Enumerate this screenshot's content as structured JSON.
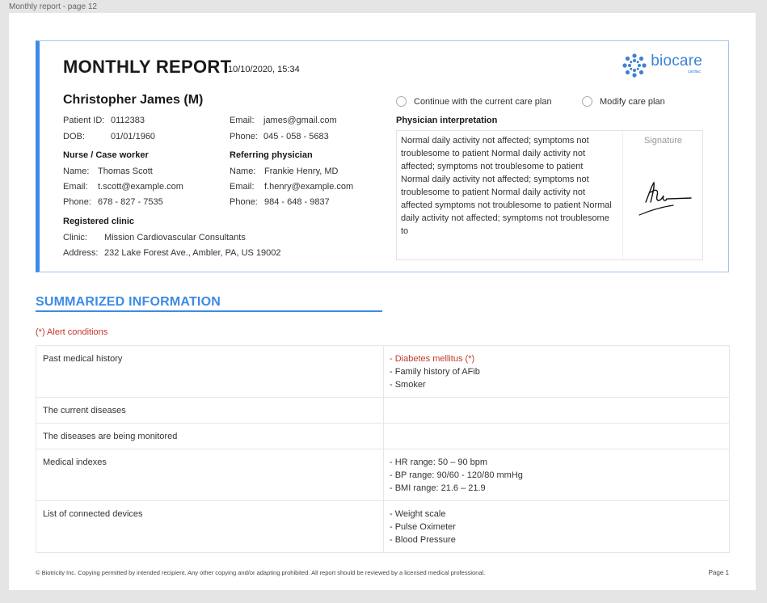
{
  "frame_label": "Monthly report - page 12",
  "report": {
    "title": "MONTHLY REPORT",
    "datetime": "10/10/2020, 15:34"
  },
  "logo": {
    "name": "biocare",
    "sub": "cardiac"
  },
  "patient": {
    "name": "Christopher James (M)",
    "id_label": "Patient ID:",
    "id": "0112383",
    "dob_label": "DOB:",
    "dob": "01/01/1960",
    "email_label": "Email:",
    "email": "james@gmail.com",
    "phone_label": "Phone:",
    "phone": "045 - 058 - 5683"
  },
  "nurse": {
    "heading": "Nurse / Case worker",
    "name_label": "Name:",
    "name": "Thomas Scott",
    "email_label": "Email:",
    "email": "t.scott@example.com",
    "phone_label": "Phone:",
    "phone": "678 - 827 - 7535"
  },
  "physician": {
    "heading": "Referring physician",
    "name_label": "Name:",
    "name": "Frankie Henry, MD",
    "email_label": "Email:",
    "email": "f.henry@example.com",
    "phone_label": "Phone:",
    "phone": "984 - 648 - 9837"
  },
  "clinic": {
    "heading": "Registered clinic",
    "clinic_label": "Clinic:",
    "clinic": "Mission Cardiovascular Consultants",
    "address_label": "Address:",
    "address": "232 Lake Forest Ave., Ambler, PA, US 19002"
  },
  "care_plan": {
    "option_continue": "Continue with the current care plan",
    "option_modify": "Modify care plan"
  },
  "interpretation": {
    "heading": "Physician interpretation",
    "text": "Normal daily activity not affected; symptoms not troublesome to patient Normal daily activity not affected; symptoms not troublesome to patient Normal daily activity not affected; symptoms not troublesome to patient Normal daily activity not affected symptoms not troublesome to patient Normal daily activity not affected; symptoms not troublesome to",
    "signature_label": "Signature"
  },
  "summary": {
    "title": "SUMMARIZED INFORMATION",
    "alert_note": "(*) Alert conditions",
    "rows": [
      {
        "label": "Past medical history",
        "items": [
          {
            "text": "- Diabetes mellitus (*)",
            "alert": true
          },
          {
            "text": "- Family history of AFib",
            "alert": false
          },
          {
            "text": "- Smoker",
            "alert": false
          }
        ]
      },
      {
        "label": "The current diseases",
        "items": []
      },
      {
        "label": "The diseases are being monitored",
        "items": []
      },
      {
        "label": "Medical indexes",
        "items": [
          {
            "text": "- HR range: 50 – 90 bpm",
            "alert": false
          },
          {
            "text": "- BP range: 90/60 - 120/80 mmHg",
            "alert": false
          },
          {
            "text": "- BMI range: 21.6 – 21.9",
            "alert": false
          }
        ]
      },
      {
        "label": "List of connected devices",
        "items": [
          {
            "text": "- Weight scale",
            "alert": false
          },
          {
            "text": "- Pulse Oximeter",
            "alert": false
          },
          {
            "text": "- Blood Pressure",
            "alert": false
          }
        ]
      }
    ]
  },
  "footer": {
    "text": "© Biotricity Inc. Copying permitted by intended recipient. Any other copying and/or adapting prohibited. All report should be reviewed by a licensed medical professional.",
    "page": "Page 1"
  },
  "colors": {
    "accent": "#3d8ae8",
    "alert": "#c0392b",
    "logo": "#3b82d6"
  }
}
